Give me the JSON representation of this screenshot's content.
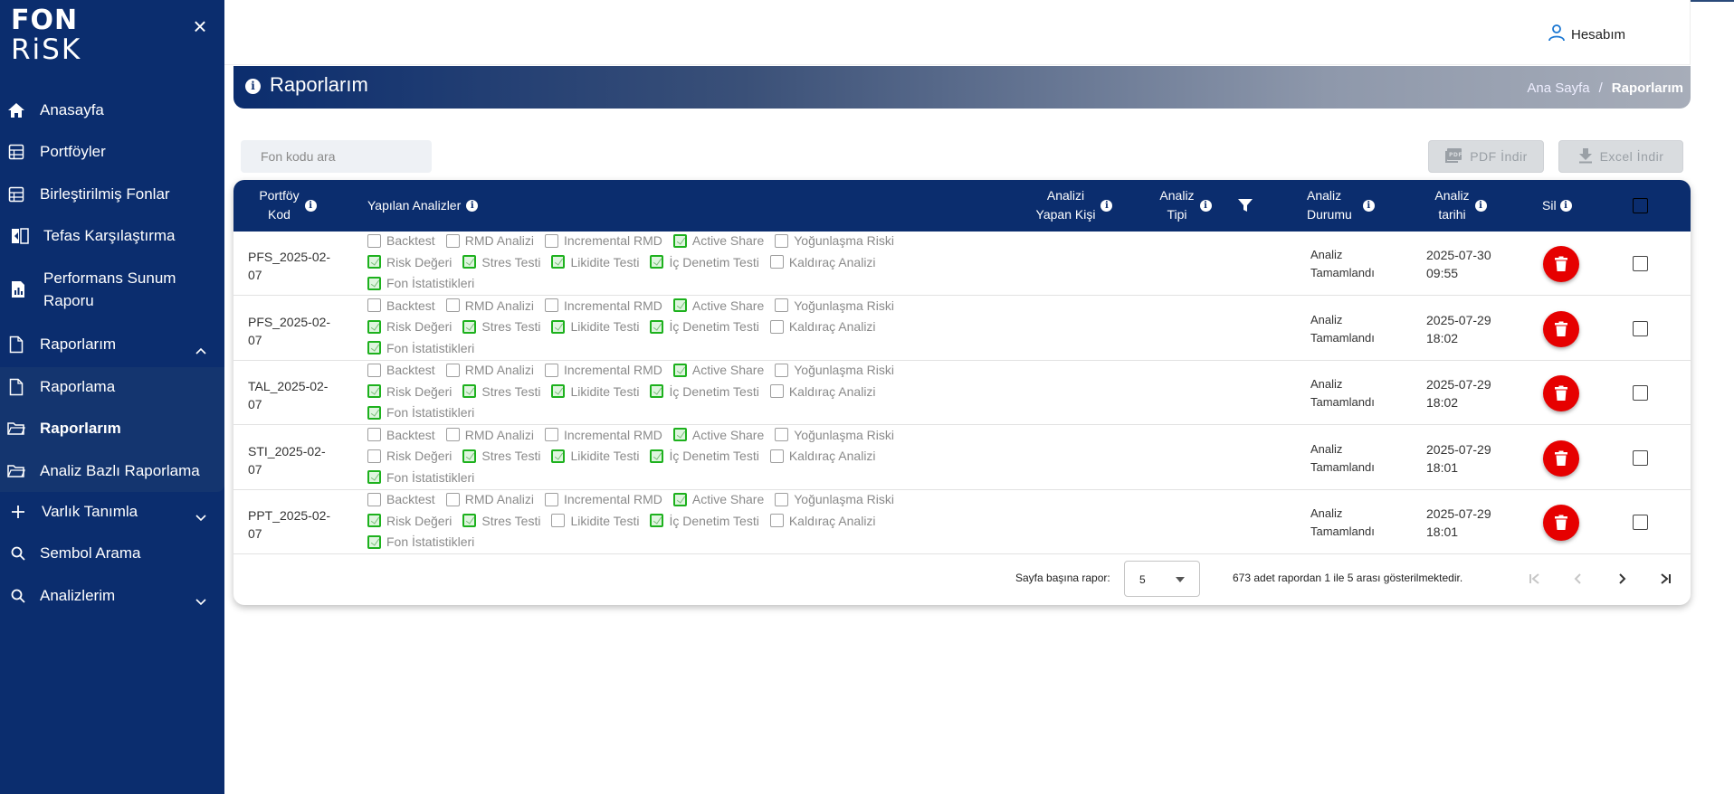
{
  "brand": {
    "line1": "FON",
    "line2": "RiSK"
  },
  "sidebar": {
    "items": [
      {
        "label": "Anasayfa",
        "icon": "home-icon"
      },
      {
        "label": "Portföyler",
        "icon": "portfolio-icon"
      },
      {
        "label": "Birleştirilmiş Fonlar",
        "icon": "merged-funds-icon"
      },
      {
        "label": "Tefas Karşılaştırma",
        "icon": "compare-icon"
      },
      {
        "label": "Performans Sunum Raporu",
        "icon": "report-icon"
      },
      {
        "label": "Raporlarım",
        "icon": "document-icon"
      },
      {
        "label": "Raporlama",
        "icon": "document-icon"
      },
      {
        "label": "Raporlarım",
        "icon": "folder-icon"
      },
      {
        "label": "Analiz Bazlı Raporlama",
        "icon": "folder-icon"
      },
      {
        "label": "Varlık Tanımla",
        "icon": "plus-icon"
      },
      {
        "label": "Sembol Arama",
        "icon": "search-icon"
      },
      {
        "label": "Analizlerim",
        "icon": "search-icon"
      }
    ]
  },
  "header": {
    "account_label": "Hesabım"
  },
  "banner": {
    "title": "Raporlarım",
    "breadcrumb": [
      "Ana Sayfa",
      "/",
      "Raporlarım"
    ]
  },
  "toolbar": {
    "search_placeholder": "Fon kodu ara",
    "pdf_label": "PDF İndir",
    "excel_label": "Excel İndir"
  },
  "table": {
    "headers": {
      "code_1": "Portföy",
      "code_2": "Kod",
      "analyses": "Yapılan Analizler",
      "by_1": "Analizi",
      "by_2": "Yapan Kişi",
      "type_1": "Analiz",
      "type_2": "Tipi",
      "status_1": "Analiz",
      "status_2": "Durumu",
      "date_1": "Analiz",
      "date_2": "tarihi",
      "delete": "Sil"
    },
    "analysis_names": [
      "Backtest",
      "RMD Analizi",
      "Incremental RMD",
      "Active Share",
      "Yoğunlaşma Riski",
      "Risk Değeri",
      "Stres Testi",
      "Likidite Testi",
      "İç Denetim Testi",
      "Kaldıraç Analizi",
      "Fon İstatistikleri"
    ],
    "rows": [
      {
        "code_1": "PFS_2025-02-",
        "code_2": "07",
        "checked": [
          false,
          false,
          false,
          true,
          false,
          true,
          true,
          true,
          true,
          false,
          true
        ],
        "status_1": "Analiz",
        "status_2": "Tamamlandı",
        "date_1": "2025-07-30",
        "date_2": "09:55"
      },
      {
        "code_1": "PFS_2025-02-",
        "code_2": "07",
        "checked": [
          false,
          false,
          false,
          true,
          false,
          true,
          true,
          true,
          true,
          false,
          true
        ],
        "status_1": "Analiz",
        "status_2": "Tamamlandı",
        "date_1": "2025-07-29",
        "date_2": "18:02"
      },
      {
        "code_1": "TAL_2025-02-",
        "code_2": "07",
        "checked": [
          false,
          false,
          false,
          true,
          false,
          true,
          true,
          true,
          true,
          false,
          true
        ],
        "status_1": "Analiz",
        "status_2": "Tamamlandı",
        "date_1": "2025-07-29",
        "date_2": "18:02"
      },
      {
        "code_1": "STI_2025-02-",
        "code_2": "07",
        "checked": [
          false,
          false,
          false,
          true,
          false,
          false,
          true,
          true,
          true,
          false,
          true
        ],
        "status_1": "Analiz",
        "status_2": "Tamamlandı",
        "date_1": "2025-07-29",
        "date_2": "18:01"
      },
      {
        "code_1": "PPT_2025-02-",
        "code_2": "07",
        "checked": [
          false,
          false,
          false,
          true,
          false,
          true,
          true,
          false,
          true,
          false,
          true
        ],
        "status_1": "Analiz",
        "status_2": "Tamamlandı",
        "date_1": "2025-07-29",
        "date_2": "18:01"
      }
    ]
  },
  "pagination": {
    "per_page_label": "Sayfa başına rapor:",
    "per_page_value": "5",
    "info": "673 adet rapordan 1 ile 5 arası gösterilmektedir."
  },
  "colors": {
    "sidebar": "#0b2d6e",
    "delete": "#e60000",
    "checked": "#1db11d"
  }
}
